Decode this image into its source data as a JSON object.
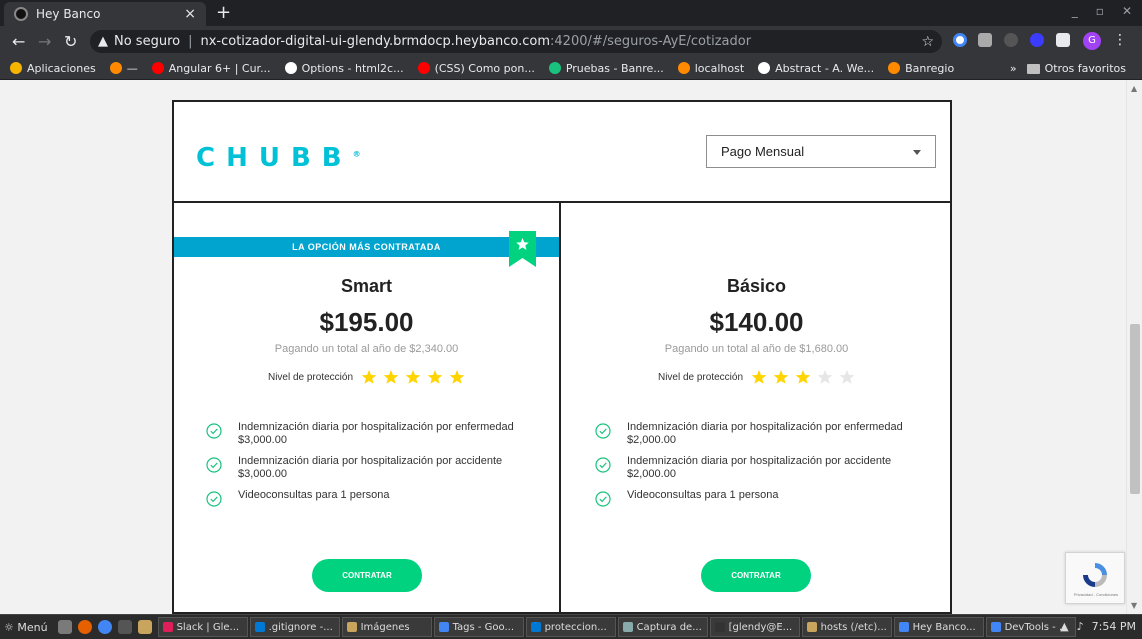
{
  "browser": {
    "tab_title": "Hey Banco",
    "tab_close": "×",
    "new_tab": "+",
    "url_warning_icon": "warning-icon",
    "url_insecure": "No seguro",
    "url_host": "nx-cotizador-digital-ui-glendy.brmdocp.heybanco.com",
    "url_path": ":4200/#/seguros-AyE/cotizador",
    "profile_initial": "G",
    "bookmarks": [
      {
        "label": "Aplicaciones",
        "color": "#f4b400"
      },
      {
        "label": "—",
        "color": "#ff8a00"
      },
      {
        "label": "Angular 6+ | Cur...",
        "color": "#ff0000"
      },
      {
        "label": "Options - html2c...",
        "color": "#ffffff"
      },
      {
        "label": "(CSS) Como pon...",
        "color": "#ff0000"
      },
      {
        "label": "Pruebas - Banre...",
        "color": "#19c37d"
      },
      {
        "label": "localhost",
        "color": "#ff8a00"
      },
      {
        "label": "Abstract - A. We...",
        "color": "#ffffff"
      },
      {
        "label": "Banregio",
        "color": "#ff8a00"
      }
    ],
    "bookmarks_more": "»",
    "other_bookmarks": "Otros favoritos"
  },
  "page": {
    "brand": "CHUBB",
    "brand_mark": "®",
    "payment_select": {
      "value": "Pago Mensual"
    },
    "plans": [
      {
        "ribbon": "LA OPCIÓN MÁS CONTRATADA",
        "name": "Smart",
        "price": "$195.00",
        "annual": "Pagando un total al año de $2,340.00",
        "level_label": "Nivel de protección",
        "stars_filled": 5,
        "stars_total": 5,
        "features": [
          "Indemnización diaria por hospitalización por enfermedad $3,000.00",
          "Indemnización diaria por hospitalización por accidente $3,000.00",
          "Videoconsultas para 1 persona"
        ],
        "cta": "CONTRATAR"
      },
      {
        "name": "Básico",
        "price": "$140.00",
        "annual": "Pagando un total al año de $1,680.00",
        "level_label": "Nivel de protección",
        "stars_filled": 3,
        "stars_total": 5,
        "features": [
          "Indemnización diaria por hospitalización por enfermedad $2,000.00",
          "Indemnización diaria por hospitalización por accidente $2,000.00",
          "Videoconsultas para 1 persona"
        ],
        "cta": "CONTRATAR"
      }
    ],
    "recaptcha_text": "Privacidad - Condiciones"
  },
  "colors": {
    "brand": "#01c1d6",
    "ribbon": "#01a4cf",
    "cta": "#00d27f",
    "star_on": "#ffd400",
    "star_off": "#e6e6e6",
    "check": "#19c37d"
  },
  "taskbar": {
    "menu": "Menú",
    "tasks": [
      {
        "label": "Slack | Gle...",
        "color": "#e01e5a"
      },
      {
        "label": ".gitignore -...",
        "color": "#0078d4"
      },
      {
        "label": "Imágenes",
        "color": "#c9a45c"
      },
      {
        "label": "Tags - Goo...",
        "color": "#4285f4"
      },
      {
        "label": "proteccion...",
        "color": "#0078d4"
      },
      {
        "label": "Captura de...",
        "color": "#8aa"
      },
      {
        "label": "[glendy@E...",
        "color": "#333"
      },
      {
        "label": "hosts (/etc)...",
        "color": "#c9a45c"
      },
      {
        "label": "Hey Banco...",
        "color": "#4285f4"
      },
      {
        "label": "DevTools - ...",
        "color": "#4285f4"
      }
    ],
    "clock": "7:54 PM"
  }
}
